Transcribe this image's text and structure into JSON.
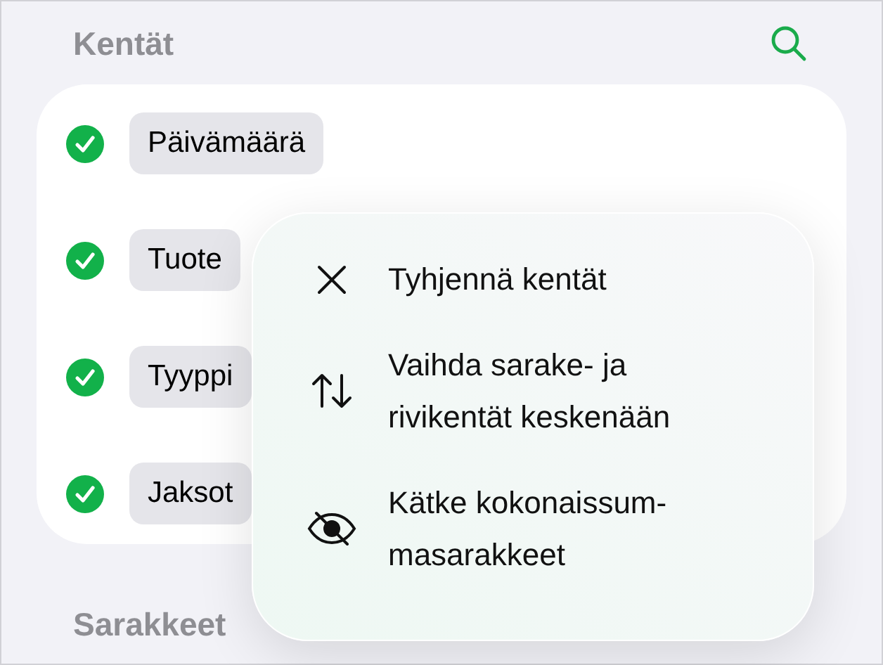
{
  "section_title": "Kentät",
  "fields": [
    {
      "label": "Päivämäärä",
      "checked": true
    },
    {
      "label": "Tuote",
      "checked": true
    },
    {
      "label": "Tyyppi",
      "checked": true
    },
    {
      "label": "Jaksot",
      "checked": true
    }
  ],
  "next_section_title": "Sarakkeet",
  "menu": [
    {
      "kind": "clear",
      "label": "Tyhjennä kentät"
    },
    {
      "kind": "swap",
      "label": "Vaihda sarake- ja rivikentät keskenään"
    },
    {
      "kind": "hide",
      "label": "Kätke kokonaissum-masarakkeet"
    }
  ]
}
